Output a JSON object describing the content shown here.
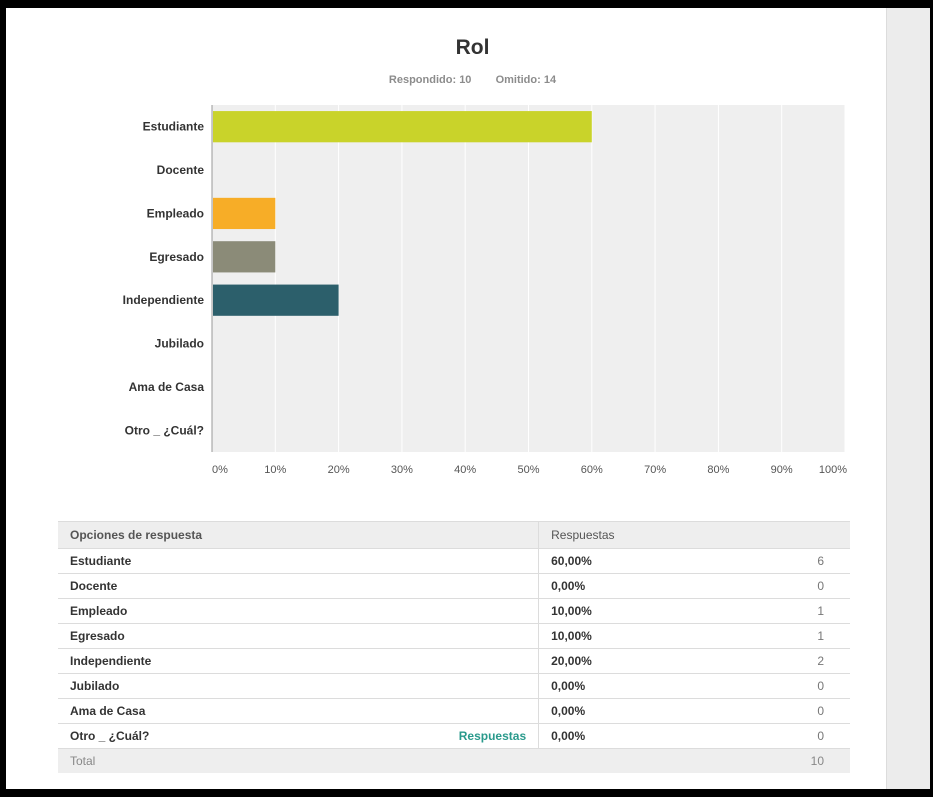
{
  "question": {
    "title": "Rol",
    "answered_label": "Respondido:",
    "answered_count": "10",
    "skipped_label": "Omitido:",
    "skipped_count": "14"
  },
  "chart_data": {
    "type": "bar",
    "orientation": "horizontal",
    "title": "Rol",
    "categories": [
      "Estudiante",
      "Docente",
      "Empleado",
      "Egresado",
      "Independiente",
      "Jubilado",
      "Ama de Casa",
      "Otro _ ¿Cuál?"
    ],
    "values": [
      60,
      0,
      10,
      10,
      20,
      0,
      0,
      0
    ],
    "value_unit": "%",
    "xlim": [
      0,
      100
    ],
    "x_ticks": [
      "0%",
      "10%",
      "20%",
      "30%",
      "40%",
      "50%",
      "60%",
      "70%",
      "80%",
      "90%",
      "100%"
    ],
    "grid": true,
    "colors": [
      "#c9d32a",
      "#6e9c3a",
      "#f7ad27",
      "#8b8b78",
      "#2c5f6b",
      "#9c9c9c",
      "#b0b0b0",
      "#c0c0c0"
    ],
    "plot_background": "#efefef"
  },
  "table": {
    "headers": [
      "Opciones de respuesta",
      "Respuestas"
    ],
    "rows": [
      {
        "option": "Estudiante",
        "percent": "60,00%",
        "count": "6"
      },
      {
        "option": "Docente",
        "percent": "0,00%",
        "count": "0"
      },
      {
        "option": "Empleado",
        "percent": "10,00%",
        "count": "1"
      },
      {
        "option": "Egresado",
        "percent": "10,00%",
        "count": "1"
      },
      {
        "option": "Independiente",
        "percent": "20,00%",
        "count": "2"
      },
      {
        "option": "Jubilado",
        "percent": "0,00%",
        "count": "0"
      },
      {
        "option": "Ama de Casa",
        "percent": "0,00%",
        "count": "0"
      },
      {
        "option": "Otro _ ¿Cuál?",
        "percent": "0,00%",
        "count": "0",
        "link": "Respuestas"
      }
    ],
    "total_label": "Total",
    "total_count": "10"
  }
}
